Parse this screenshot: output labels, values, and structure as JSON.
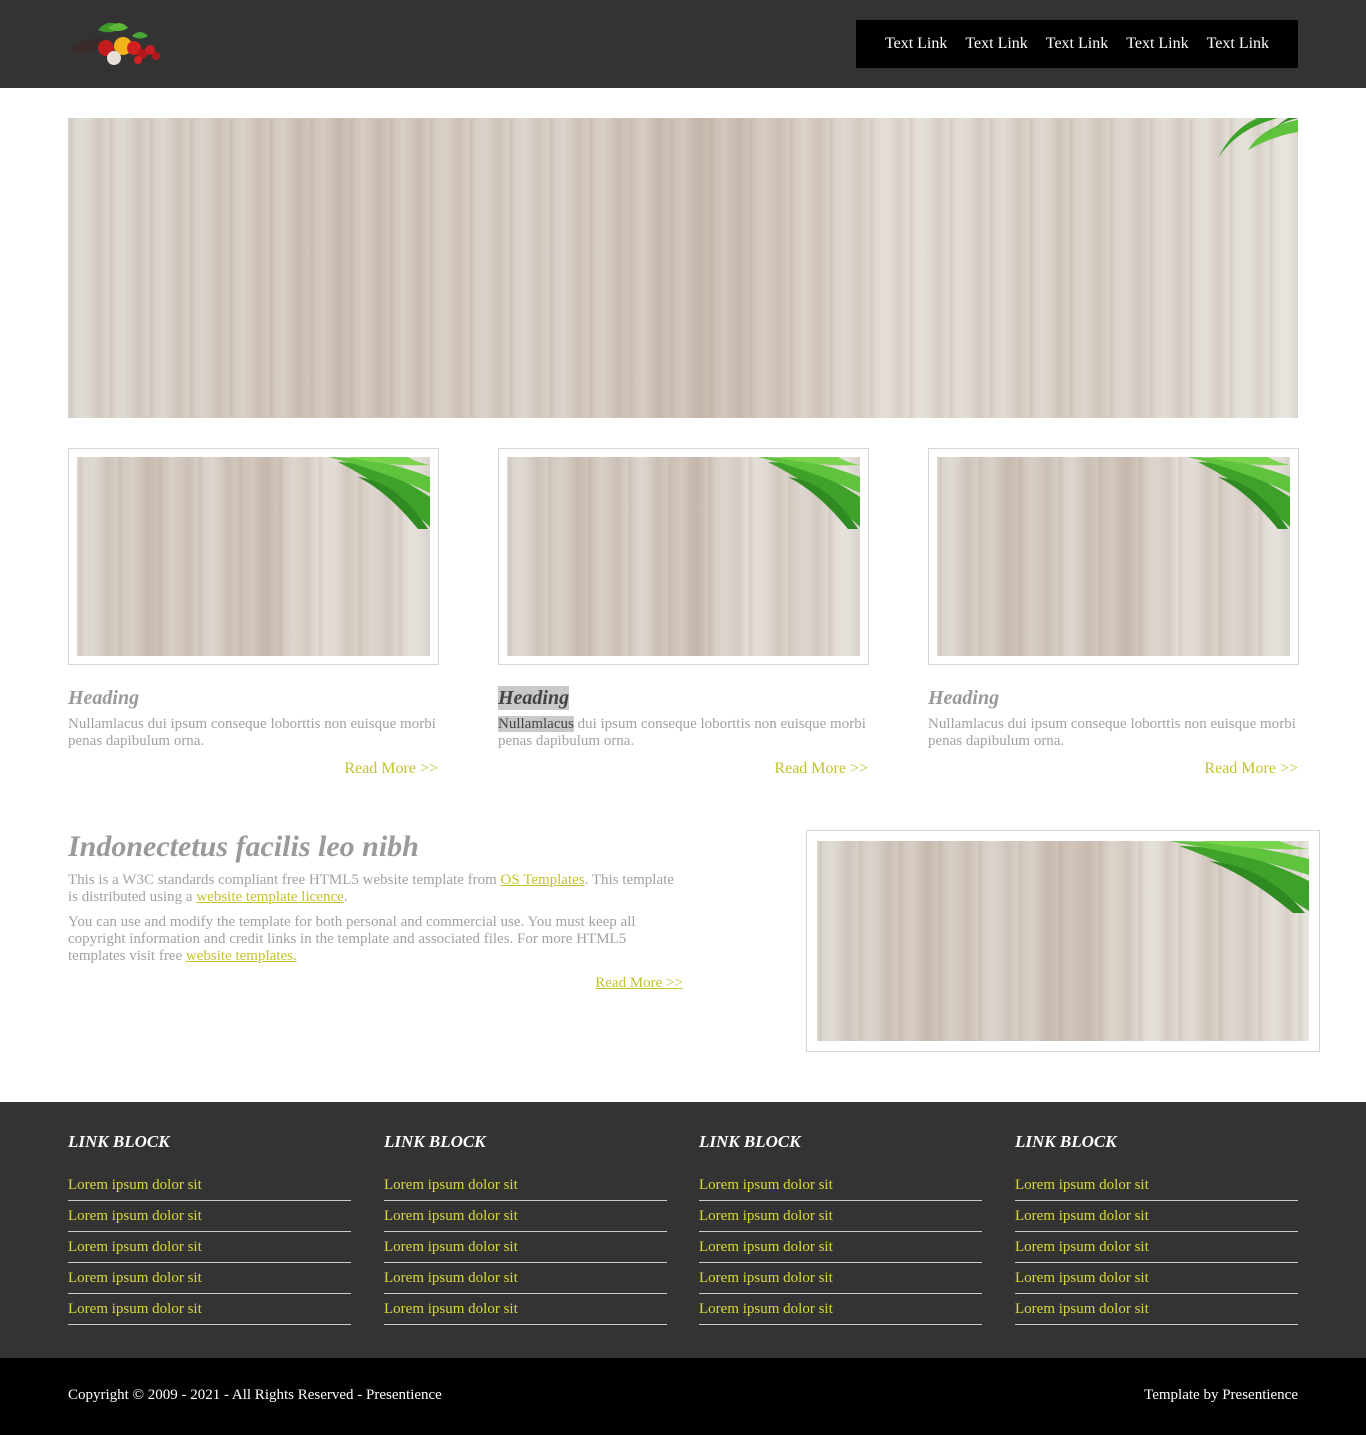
{
  "header": {
    "logo_alt": "vegetables logo",
    "nav": [
      "Text Link",
      "Text Link",
      "Text Link",
      "Text Link",
      "Text Link"
    ]
  },
  "cards": [
    {
      "heading": "Heading",
      "text": "Nullamlacus dui ipsum conseque loborttis non euisque morbi penas dapibulum orna.",
      "more": "Read More >>"
    },
    {
      "heading": "Heading",
      "text_highlight": "Nullamlacus",
      "text_rest": " dui ipsum conseque loborttis non euisque morbi penas dapibulum orna.",
      "more": "Read More >>"
    },
    {
      "heading": "Heading",
      "text": "Nullamlacus dui ipsum conseque loborttis non euisque morbi penas dapibulum orna.",
      "more": "Read More >>"
    }
  ],
  "intro": {
    "title": "Indonectetus facilis leo nibh",
    "p1_a": "This is a W3C standards compliant free HTML5 website template from ",
    "p1_link1": "OS Templates",
    "p1_b": ". This template is distributed using a ",
    "p1_link2": "website template licence",
    "p1_c": ".",
    "p2_a": "You can use and modify the template for both personal and commercial use. You must keep all copyright information and credit links in the template and associated files. For more HTML5 templates visit free ",
    "p2_link": "website templates.",
    "more": "Read More >>"
  },
  "footer": {
    "columns": [
      {
        "title": "LINK BLOCK",
        "links": [
          "Lorem ipsum dolor sit",
          "Lorem ipsum dolor sit",
          "Lorem ipsum dolor sit",
          "Lorem ipsum dolor sit",
          "Lorem ipsum dolor sit"
        ]
      },
      {
        "title": "LINK BLOCK",
        "links": [
          "Lorem ipsum dolor sit",
          "Lorem ipsum dolor sit",
          "Lorem ipsum dolor sit",
          "Lorem ipsum dolor sit",
          "Lorem ipsum dolor sit"
        ]
      },
      {
        "title": "LINK BLOCK",
        "links": [
          "Lorem ipsum dolor sit",
          "Lorem ipsum dolor sit",
          "Lorem ipsum dolor sit",
          "Lorem ipsum dolor sit",
          "Lorem ipsum dolor sit"
        ]
      },
      {
        "title": "LINK BLOCK",
        "links": [
          "Lorem ipsum dolor sit",
          "Lorem ipsum dolor sit",
          "Lorem ipsum dolor sit",
          "Lorem ipsum dolor sit",
          "Lorem ipsum dolor sit"
        ]
      }
    ]
  },
  "copyright": {
    "left": "Copyright © 2009 - 2021 - All Rights Reserved - Presentience",
    "right": "Template by Presentience"
  },
  "colors": {
    "header_bg": "#333333",
    "nav_bg": "#000000",
    "accent": "#c3c32e",
    "footer_link": "#d8d83a"
  }
}
